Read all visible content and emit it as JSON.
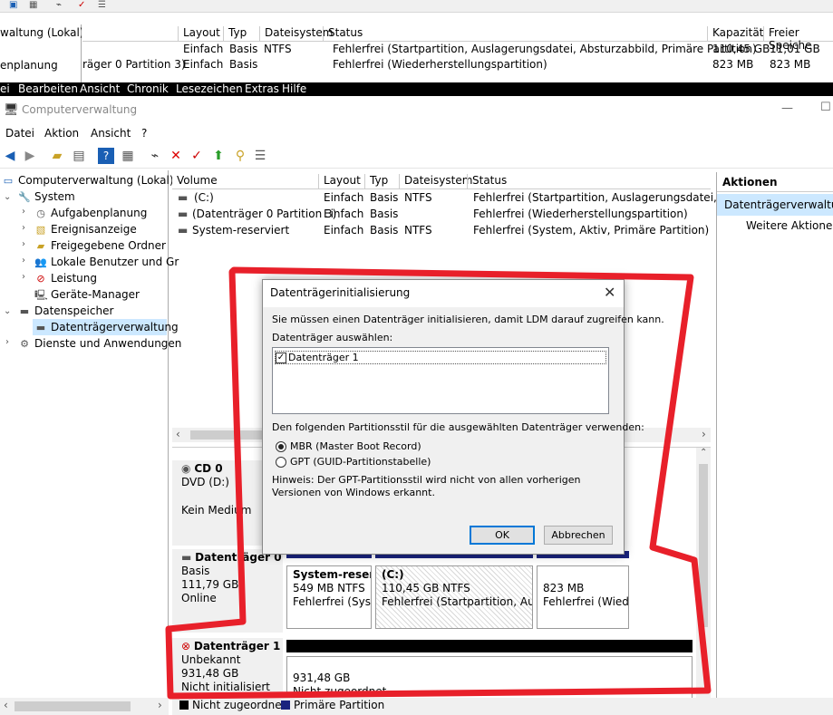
{
  "bg_window": {
    "tree_label": "waltung (Lokal)",
    "tree_item": "enplanung",
    "headers": [
      "Layout",
      "Typ",
      "Dateisystem",
      "Status",
      "Kapazität",
      "Freier Speiche"
    ],
    "rows": [
      {
        "volume": "",
        "layout": "Einfach",
        "typ": "Basis",
        "fs": "NTFS",
        "status": "Fehlerfrei (Startpartition, Auslagerungsdatei, Absturzabbild, Primäre Partition)",
        "cap": "110,45 GB",
        "free": "11,01 GB"
      },
      {
        "volume": "räger 0 Partition 3)",
        "layout": "Einfach",
        "typ": "Basis",
        "fs": "",
        "status": "Fehlerfrei (Wiederherstellungspartition)",
        "cap": "823 MB",
        "free": "823 MB"
      }
    ]
  },
  "black_menu": [
    "ei",
    "Bearbeiten",
    "Ansicht",
    "Chronik",
    "Lesezeichen",
    "Extras",
    "Hilfe"
  ],
  "window": {
    "title": "Computerverwaltung",
    "menu": [
      "Datei",
      "Aktion",
      "Ansicht",
      "?"
    ]
  },
  "tree": {
    "root": "Computerverwaltung (Lokal)",
    "system": "System",
    "system_items": [
      "Aufgabenplanung",
      "Ereignisanzeige",
      "Freigegebene Ordner",
      "Lokale Benutzer und Gr",
      "Leistung",
      "Geräte-Manager"
    ],
    "storage": "Datenspeicher",
    "storage_items": [
      "Datenträgerverwaltung"
    ],
    "services": "Dienste und Anwendungen"
  },
  "grid": {
    "headers": [
      "Volume",
      "Layout",
      "Typ",
      "Dateisystem",
      "Status"
    ],
    "rows": [
      {
        "volume": "(C:)",
        "layout": "Einfach",
        "typ": "Basis",
        "fs": "NTFS",
        "status": "Fehlerfrei (Startpartition, Auslagerungsdatei, Abstu"
      },
      {
        "volume": "(Datenträger 0 Partition 3)",
        "layout": "Einfach",
        "typ": "Basis",
        "fs": "",
        "status": "Fehlerfrei (Wiederherstellungspartition)"
      },
      {
        "volume": "System-reserviert",
        "layout": "Einfach",
        "typ": "Basis",
        "fs": "NTFS",
        "status": "Fehlerfrei (System, Aktiv, Primäre Partition)"
      }
    ]
  },
  "disks": {
    "cd": {
      "name": "CD 0",
      "type": "DVD (D:)",
      "media": "Kein Medium"
    },
    "disk0": {
      "name": "Datenträger 0",
      "type": "Basis",
      "size": "111,79 GB",
      "state": "Online",
      "parts": [
        {
          "name": "System-reserv",
          "size": "549 MB NTFS",
          "status": "Fehlerfrei (Syste"
        },
        {
          "name": "(C:)",
          "size": "110,45 GB NTFS",
          "status": "Fehlerfrei (Startpartition, Auslag"
        },
        {
          "name": "",
          "size": "823 MB",
          "status": "Fehlerfrei (Wiede"
        }
      ]
    },
    "disk1": {
      "name": "Datenträger 1",
      "type": "Unbekannt",
      "size": "931,48 GB",
      "state": "Nicht initialisiert",
      "part_size": "931,48 GB",
      "part_status": "Nicht zugeordnet"
    }
  },
  "legend": [
    "Nicht zugeordnet",
    "Primäre Partition"
  ],
  "actions": {
    "title": "Aktionen",
    "section": "Datenträgerverwaltung",
    "more": "Weitere Aktionen"
  },
  "dialog": {
    "title": "Datenträgerinitialisierung",
    "intro": "Sie müssen einen Datenträger initialisieren, damit LDM darauf zugreifen kann.",
    "select_label": "Datenträger auswählen:",
    "disk_item": "Datenträger 1",
    "style_label": "Den folgenden Partitionsstil für die ausgewählten Datenträger verwenden:",
    "mbr": "MBR (Master Boot Record)",
    "gpt": "GPT (GUID-Partitionstabelle)",
    "hint": "Hinweis: Der GPT-Partitionsstil wird nicht von allen vorherigen Versionen von Windows erkannt.",
    "ok": "OK",
    "cancel": "Abbrechen"
  },
  "colors": {
    "highlight": "#cce8ff",
    "primary_partition": "#1a237e",
    "annotation": "#e8202a"
  }
}
